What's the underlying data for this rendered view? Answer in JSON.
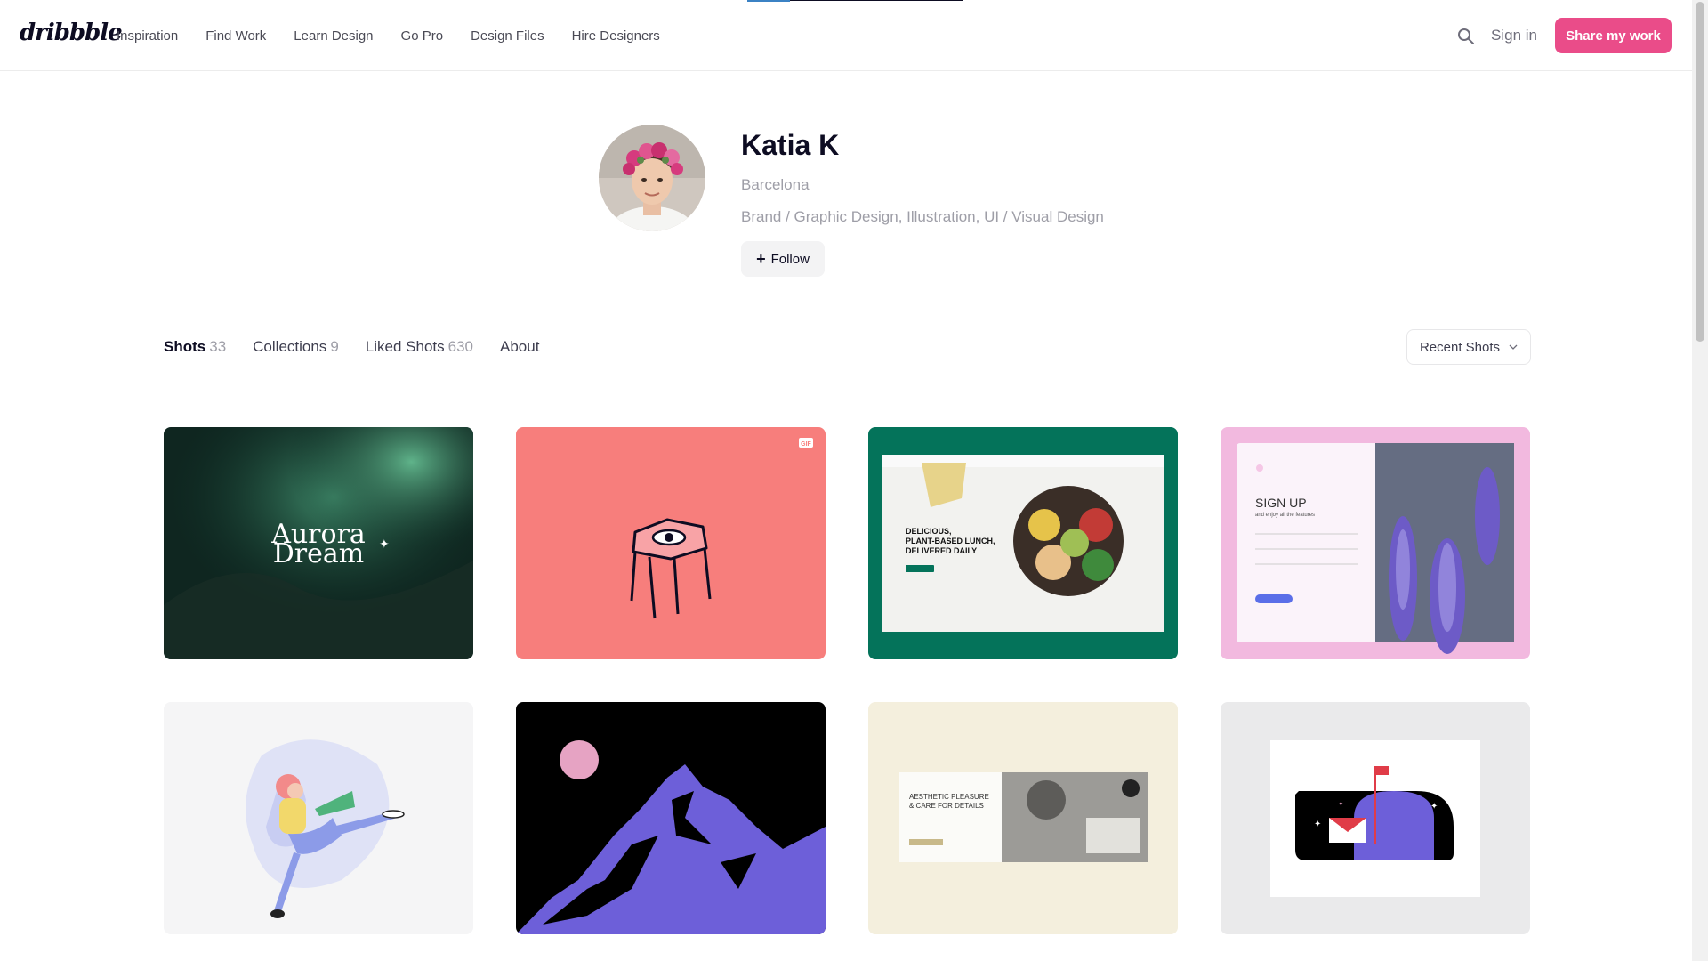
{
  "header": {
    "logo": "dribbble",
    "nav": [
      "Inspiration",
      "Find Work",
      "Learn Design",
      "Go Pro",
      "Design Files",
      "Hire Designers"
    ],
    "signin": "Sign in",
    "share": "Share my work"
  },
  "profile": {
    "name": "Katia K",
    "location": "Barcelona",
    "skills": "Brand / Graphic Design, Illustration, UI / Visual Design",
    "follow": "Follow"
  },
  "tabs": [
    {
      "label": "Shots",
      "count": "33"
    },
    {
      "label": "Collections",
      "count": "9"
    },
    {
      "label": "Liked Shots",
      "count": "630"
    },
    {
      "label": "About",
      "count": ""
    }
  ],
  "sort": "Recent Shots",
  "shots": {
    "aurora": {
      "line1": "Aurora",
      "line2": "Dream"
    },
    "gif_badge": "GIF",
    "food": {
      "line1": "DELICIOUS,",
      "line2": "PLANT-BASED LUNCH,",
      "line3": "DELIVERED DAILY"
    },
    "signup": {
      "title": "SIGN UP",
      "subtitle": "and enjoy all the features"
    },
    "aesthetic": {
      "line1": "AESTHETIC PLEASURE",
      "line2": "& CARE FOR DETAILS"
    }
  },
  "colors": {
    "brand_pink": "#ea4c89",
    "text_dark": "#0d0c22",
    "text_muted": "#9e9ea7"
  }
}
